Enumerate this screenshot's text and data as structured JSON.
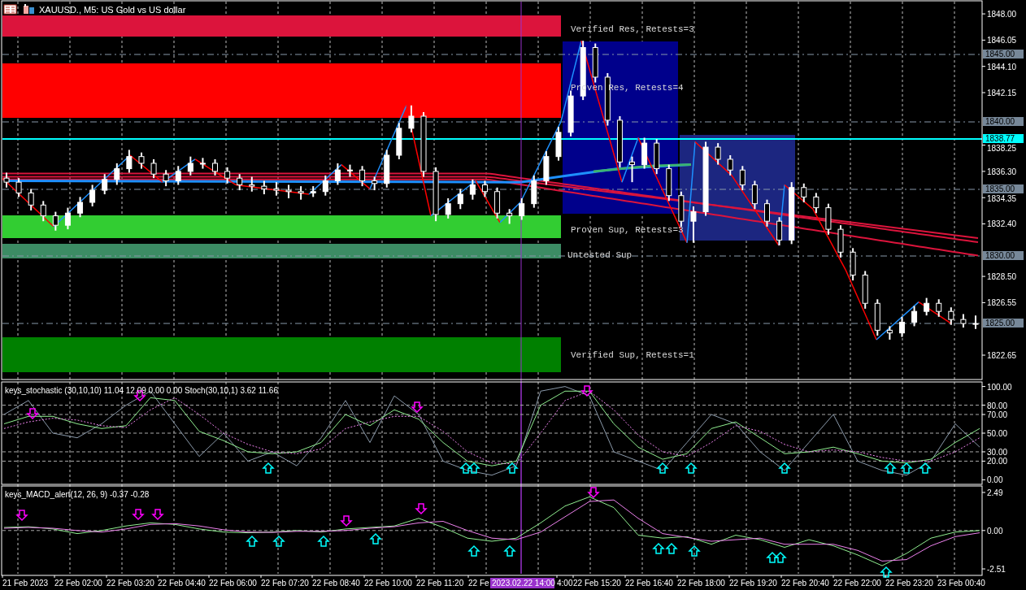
{
  "window": {
    "title": "XAUUSD., M5:  US Gold vs US dollar"
  },
  "price_chart": {
    "zones": [
      {
        "label": "Verified Res, Retests=3",
        "color": "#dc143c"
      },
      {
        "label": "Proven Res, Retests=4",
        "color": "#ff0000"
      },
      {
        "label": "Proven Sup, Retests=3",
        "color": "#32cd32"
      },
      {
        "label": "Untested Sup",
        "color": "#3c8c64"
      },
      {
        "label": "Verified Sup, Retests=1",
        "color": "#008000"
      }
    ],
    "level_badges": [
      {
        "text": "1845.00",
        "kind": "grid"
      },
      {
        "text": "1840.00",
        "kind": "grid"
      },
      {
        "text": "1838.77",
        "kind": "current"
      },
      {
        "text": "1835.00",
        "kind": "grid"
      },
      {
        "text": "1830.00",
        "kind": "grid"
      },
      {
        "text": "1825.00",
        "kind": "grid"
      }
    ],
    "chart_data": {
      "type": "candlestick",
      "ylim": [
        1820.84,
        1848.97
      ],
      "yticks": [
        {
          "value": 1848,
          "label": "1848.00"
        },
        {
          "value": 1846.05,
          "label": "1846.05"
        },
        {
          "value": 1844.1,
          "label": "1844.10"
        },
        {
          "value": 1842.15,
          "label": "1842.15"
        },
        {
          "value": 1838.25,
          "label": "1838.25"
        },
        {
          "value": 1836.3,
          "label": "1836.30"
        },
        {
          "value": 1834.35,
          "label": "1834.35"
        },
        {
          "value": 1832.4,
          "label": "1832.40"
        },
        {
          "value": 1828.5,
          "label": "1828.50"
        },
        {
          "value": 1826.55,
          "label": "1826.55"
        },
        {
          "value": 1822.65,
          "label": "1822.65"
        }
      ],
      "ohlc": [
        [
          1835.8,
          1836.2,
          1835.1,
          1835.5
        ],
        [
          1835.5,
          1835.8,
          1834.4,
          1834.7
        ],
        [
          1834.7,
          1835.0,
          1833.4,
          1833.8
        ],
        [
          1833.8,
          1834.1,
          1832.6,
          1833.0
        ],
        [
          1833.0,
          1833.3,
          1831.9,
          1832.3
        ],
        [
          1832.3,
          1833.6,
          1832.0,
          1833.2
        ],
        [
          1833.2,
          1834.4,
          1832.9,
          1834.0
        ],
        [
          1834.0,
          1835.3,
          1833.7,
          1834.9
        ],
        [
          1834.9,
          1836.1,
          1834.6,
          1835.7
        ],
        [
          1835.7,
          1836.9,
          1835.3,
          1836.5
        ],
        [
          1836.5,
          1837.9,
          1836.2,
          1837.4
        ],
        [
          1837.4,
          1837.7,
          1836.5,
          1836.9
        ],
        [
          1836.9,
          1837.2,
          1835.8,
          1836.1
        ],
        [
          1836.1,
          1836.4,
          1835.2,
          1835.6
        ],
        [
          1835.6,
          1836.7,
          1835.3,
          1836.3
        ],
        [
          1836.3,
          1837.4,
          1836.0,
          1836.9
        ],
        [
          1836.9,
          1837.3,
          1836.5,
          1836.9
        ],
        [
          1836.9,
          1837.2,
          1836.0,
          1836.3
        ],
        [
          1836.3,
          1836.6,
          1835.4,
          1835.8
        ],
        [
          1835.8,
          1836.1,
          1834.9,
          1835.3
        ],
        [
          1835.3,
          1835.9,
          1834.8,
          1835.2
        ],
        [
          1835.2,
          1835.6,
          1834.6,
          1835.0
        ],
        [
          1835.0,
          1835.5,
          1834.5,
          1834.9
        ],
        [
          1834.9,
          1835.3,
          1834.3,
          1834.8
        ],
        [
          1834.8,
          1835.2,
          1834.2,
          1834.7
        ],
        [
          1834.7,
          1835.2,
          1834.4,
          1834.8
        ],
        [
          1834.8,
          1836.0,
          1834.5,
          1835.6
        ],
        [
          1835.6,
          1836.9,
          1835.3,
          1836.4
        ],
        [
          1836.4,
          1836.8,
          1835.9,
          1836.4
        ],
        [
          1836.4,
          1836.7,
          1835.2,
          1835.6
        ],
        [
          1835.6,
          1835.9,
          1834.9,
          1835.4
        ],
        [
          1835.4,
          1837.9,
          1835.1,
          1837.5
        ],
        [
          1837.5,
          1839.9,
          1837.2,
          1839.5
        ],
        [
          1839.5,
          1841.2,
          1839.2,
          1840.4
        ],
        [
          1840.4,
          1840.7,
          1835.9,
          1836.3
        ],
        [
          1836.3,
          1836.6,
          1832.6,
          1833.1
        ],
        [
          1833.1,
          1834.3,
          1832.8,
          1833.9
        ],
        [
          1833.9,
          1835.0,
          1833.5,
          1834.6
        ],
        [
          1834.6,
          1835.7,
          1834.2,
          1835.3
        ],
        [
          1835.3,
          1835.6,
          1834.4,
          1834.8
        ],
        [
          1834.8,
          1835.1,
          1832.8,
          1833.2
        ],
        [
          1833.2,
          1833.5,
          1832.4,
          1833.0
        ],
        [
          1833.0,
          1834.3,
          1832.7,
          1833.9
        ],
        [
          1833.9,
          1836.0,
          1833.6,
          1835.6
        ],
        [
          1835.6,
          1837.8,
          1835.3,
          1837.4
        ],
        [
          1837.4,
          1839.6,
          1837.1,
          1839.2
        ],
        [
          1839.2,
          1842.3,
          1838.9,
          1841.9
        ],
        [
          1841.9,
          1846.0,
          1841.6,
          1845.5
        ],
        [
          1845.5,
          1845.8,
          1842.9,
          1843.3
        ],
        [
          1843.3,
          1843.6,
          1839.7,
          1840.1
        ],
        [
          1840.1,
          1840.4,
          1836.6,
          1837.0
        ],
        [
          1837.0,
          1837.4,
          1835.5,
          1836.8
        ],
        [
          1836.8,
          1838.8,
          1836.5,
          1838.4
        ],
        [
          1838.4,
          1838.7,
          1836.1,
          1836.5
        ],
        [
          1836.5,
          1836.8,
          1834.1,
          1834.5
        ],
        [
          1834.5,
          1834.8,
          1832.2,
          1832.6
        ],
        [
          1832.6,
          1833.7,
          1831.0,
          1833.3
        ],
        [
          1833.3,
          1838.5,
          1833.0,
          1838.1
        ],
        [
          1838.1,
          1838.4,
          1836.8,
          1837.2
        ],
        [
          1837.2,
          1837.5,
          1836.0,
          1836.4
        ],
        [
          1836.4,
          1836.7,
          1834.9,
          1835.3
        ],
        [
          1835.3,
          1835.6,
          1833.5,
          1833.9
        ],
        [
          1833.9,
          1834.2,
          1832.2,
          1832.6
        ],
        [
          1832.6,
          1832.9,
          1830.8,
          1831.2
        ],
        [
          1831.2,
          1835.5,
          1830.9,
          1835.1
        ],
        [
          1835.1,
          1835.4,
          1834.0,
          1834.4
        ],
        [
          1834.4,
          1834.7,
          1833.2,
          1833.6
        ],
        [
          1833.6,
          1833.9,
          1831.6,
          1832.0
        ],
        [
          1832.0,
          1832.3,
          1829.9,
          1830.3
        ],
        [
          1830.3,
          1830.6,
          1828.2,
          1828.6
        ],
        [
          1828.6,
          1828.9,
          1826.1,
          1826.5
        ],
        [
          1826.5,
          1826.8,
          1824.1,
          1824.5
        ],
        [
          1824.5,
          1824.8,
          1823.8,
          1824.3
        ],
        [
          1824.3,
          1825.5,
          1824.0,
          1825.1
        ],
        [
          1825.1,
          1826.3,
          1824.8,
          1825.9
        ],
        [
          1825.9,
          1826.9,
          1825.6,
          1826.5
        ],
        [
          1826.5,
          1826.8,
          1825.5,
          1825.9
        ],
        [
          1825.9,
          1826.2,
          1824.9,
          1825.3
        ],
        [
          1825.3,
          1825.7,
          1824.7,
          1825.0
        ],
        [
          1825.0,
          1825.6,
          1824.6,
          1825.0
        ]
      ]
    }
  },
  "stochastic": {
    "label": "keys_stochastic (30,10,10) 11.04 12.09 0.00 0.00 Stoch(30,10,1) 3.62 11.66",
    "chart_data": {
      "type": "line",
      "ylim": [
        -4,
        104
      ],
      "yticks": [
        {
          "value": 100,
          "label": "100.00"
        },
        {
          "value": 80,
          "label": "80.00"
        },
        {
          "value": 70,
          "label": "70.00"
        },
        {
          "value": 50,
          "label": "50.00"
        },
        {
          "value": 30,
          "label": "30.00"
        },
        {
          "value": 20,
          "label": "20.00"
        },
        {
          "value": 0,
          "label": "0.00"
        }
      ],
      "series": [
        {
          "color": "#8a99aa",
          "values": [
            70,
            85,
            50,
            45,
            60,
            80,
            95,
            60,
            25,
            50,
            20,
            30,
            15,
            45,
            85,
            40,
            90,
            70,
            20,
            10,
            5,
            15,
            95,
            100,
            90,
            30,
            20,
            10,
            40,
            70,
            60,
            30,
            10,
            40,
            70,
            20,
            10,
            5,
            20,
            60,
            35
          ]
        },
        {
          "color": "#90ee90",
          "values": [
            60,
            68,
            68,
            60,
            55,
            58,
            88,
            85,
            52,
            42,
            30,
            28,
            30,
            40,
            70,
            58,
            75,
            65,
            40,
            20,
            15,
            20,
            80,
            95,
            95,
            60,
            35,
            22,
            28,
            55,
            62,
            45,
            28,
            30,
            35,
            28,
            20,
            18,
            22,
            40,
            55
          ]
        },
        {
          "color": "#ee82ee",
          "line_style": "dashed",
          "values": [
            55,
            62,
            66,
            64,
            58,
            56,
            75,
            88,
            70,
            50,
            38,
            30,
            28,
            33,
            55,
            62,
            68,
            68,
            52,
            30,
            18,
            17,
            50,
            85,
            95,
            75,
            48,
            30,
            25,
            40,
            58,
            52,
            38,
            30,
            32,
            30,
            24,
            20,
            20,
            30,
            45
          ]
        }
      ]
    }
  },
  "macd": {
    "label": "keys_MACD_alert(12, 26, 9) -0.37 -0.28",
    "chart_data": {
      "type": "line",
      "ylim": [
        -2.88,
        2.86
      ],
      "yticks": [
        {
          "value": 2.49,
          "label": "2.49"
        },
        {
          "value": 0,
          "label": "0.00"
        },
        {
          "value": -2.51,
          "label": "-2.51"
        }
      ],
      "series": [
        {
          "color": "#90ee90",
          "values": [
            0.2,
            0.25,
            0.1,
            -0.2,
            0.0,
            0.3,
            0.5,
            0.4,
            0.1,
            -0.1,
            -0.15,
            -0.1,
            0.0,
            -0.1,
            0.1,
            0.2,
            0.3,
            0.8,
            0.2,
            -0.5,
            -0.7,
            -0.5,
            0.5,
            1.6,
            2.2,
            1.5,
            -0.3,
            -0.5,
            -0.4,
            -0.9,
            -0.3,
            -0.6,
            -1.1,
            -0.6,
            -1.0,
            -1.6,
            -2.3,
            -1.5,
            -0.5,
            -0.1,
            0.0
          ]
        },
        {
          "color": "#ee82ee",
          "values": [
            0.15,
            0.2,
            0.15,
            0.0,
            -0.1,
            0.1,
            0.4,
            0.45,
            0.3,
            0.05,
            -0.1,
            -0.12,
            -0.05,
            -0.05,
            0.0,
            0.15,
            0.25,
            0.5,
            0.6,
            0.0,
            -0.5,
            -0.6,
            -0.1,
            0.9,
            1.9,
            2.0,
            0.8,
            -0.2,
            -0.45,
            -0.7,
            -0.6,
            -0.5,
            -0.9,
            -0.9,
            -0.9,
            -1.3,
            -2.0,
            -1.9,
            -1.0,
            -0.4,
            -0.15
          ]
        }
      ]
    }
  },
  "time_axis": {
    "labels": [
      "21 Feb 2023",
      "22 Feb 02:00",
      "22 Feb 03:20",
      "22 Feb 04:40",
      "22 Feb 06:00",
      "22 Feb 07:20",
      "22 Feb 08:40",
      "22 Feb 10:00",
      "22 Feb 11:20",
      "22 Fe",
      "4:00",
      "22 Feb 15:20",
      "22 Feb 16:40",
      "22 Feb 18:00",
      "22 Feb 19:20",
      "22 Feb 20:40",
      "22 Feb 22:00",
      "22 Feb 23:20",
      "23 Feb 00:40"
    ],
    "cursor_time": "2023.02.22 14:00"
  }
}
